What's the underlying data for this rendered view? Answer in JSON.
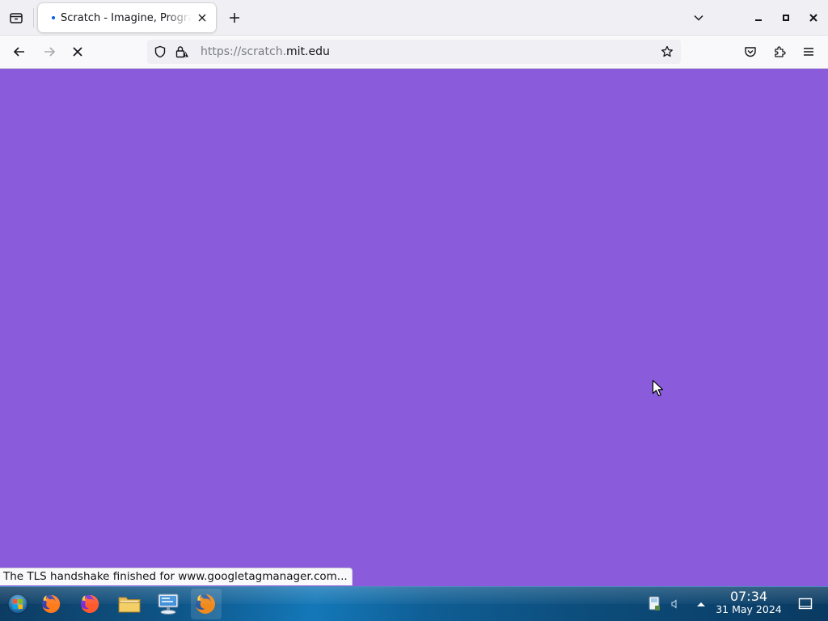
{
  "browser": {
    "tab": {
      "title": "Scratch - Imagine, Program, Create",
      "loading": true
    },
    "url": {
      "scheme": "https://",
      "subdomain": "scratch.",
      "host": "mit.edu"
    },
    "status_text": "The TLS handshake finished for www.googletagmanager.com..."
  },
  "page": {
    "background_color": "#8a5cdb"
  },
  "taskbar": {
    "items": [
      "start-orb",
      "firefox",
      "firefox",
      "file-manager",
      "network-computer",
      "firefox"
    ],
    "clock": {
      "time": "07:34",
      "date": "31 May 2024"
    }
  },
  "icons": {
    "tab_list": "tab-list-icon",
    "new_tab": "plus-icon",
    "list_all_tabs": "chevron-down-icon",
    "back": "arrow-left-icon",
    "forward": "arrow-right-icon",
    "stop": "close-icon",
    "tracking_protection": "shield-icon",
    "connection": "lock-warning-icon",
    "bookmark": "star-icon",
    "pocket": "pocket-icon",
    "extensions": "puzzle-icon",
    "app_menu": "hamburger-icon"
  }
}
